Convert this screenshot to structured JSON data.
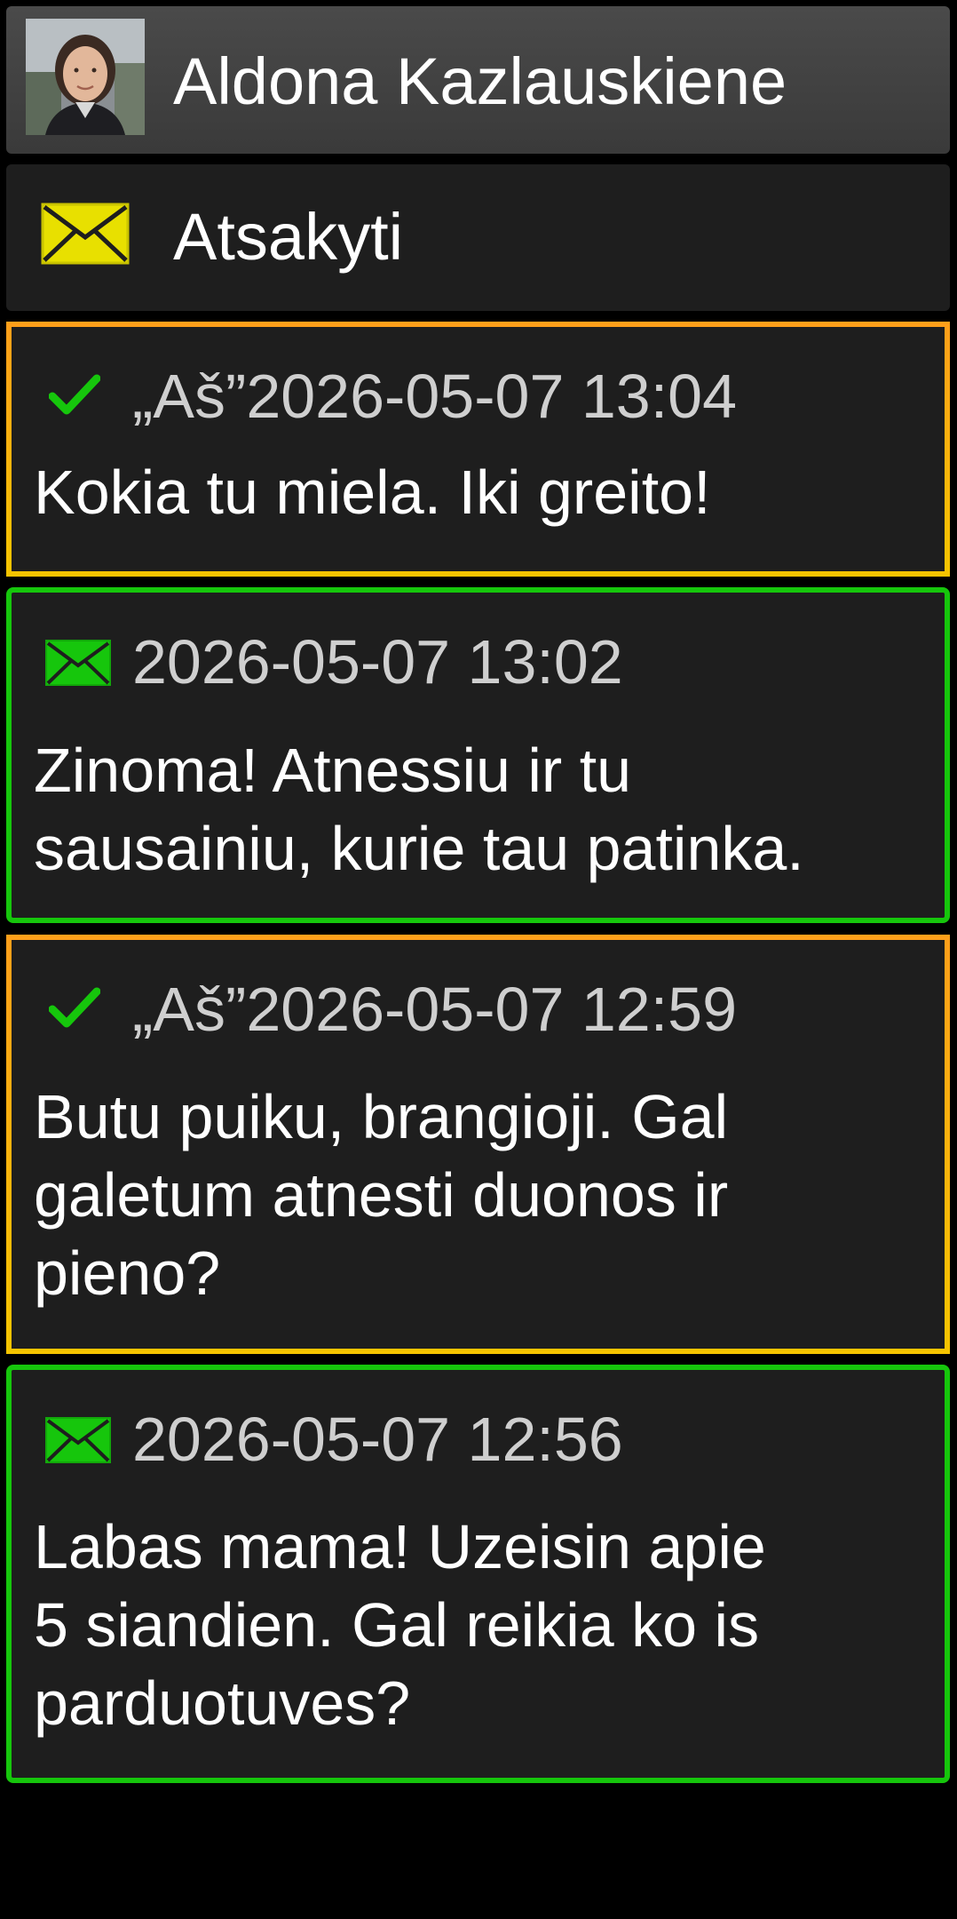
{
  "contact": {
    "name": "Aldona Kazlauskiene",
    "avatar_icon": "person-photo"
  },
  "reply": {
    "label": "Atsakyti",
    "icon": "envelope-icon",
    "icon_color": "#e8e000"
  },
  "colors": {
    "sent_border": "#f5b400",
    "received_border": "#16c60c",
    "check": "#16c60c",
    "envelope_received": "#16c60c"
  },
  "messages": [
    {
      "direction": "sent",
      "sender": "„Aš”",
      "timestamp": "2026-05-07 13:04",
      "text": "Kokia tu miela. Iki greito!"
    },
    {
      "direction": "received",
      "sender": "",
      "timestamp": "2026-05-07 13:02",
      "text": "Zinoma! Atnessiu ir tu\nsausainiu, kurie tau patinka."
    },
    {
      "direction": "sent",
      "sender": "„Aš”",
      "timestamp": "2026-05-07 12:59",
      "text": "Butu puiku, brangioji. Gal\ngaletum atnesti duonos ir\npieno?"
    },
    {
      "direction": "received",
      "sender": "",
      "timestamp": "2026-05-07 12:56",
      "text": "Labas mama! Uzeisin apie\n5 siandien. Gal reikia ko is\nparduotuves?"
    }
  ]
}
